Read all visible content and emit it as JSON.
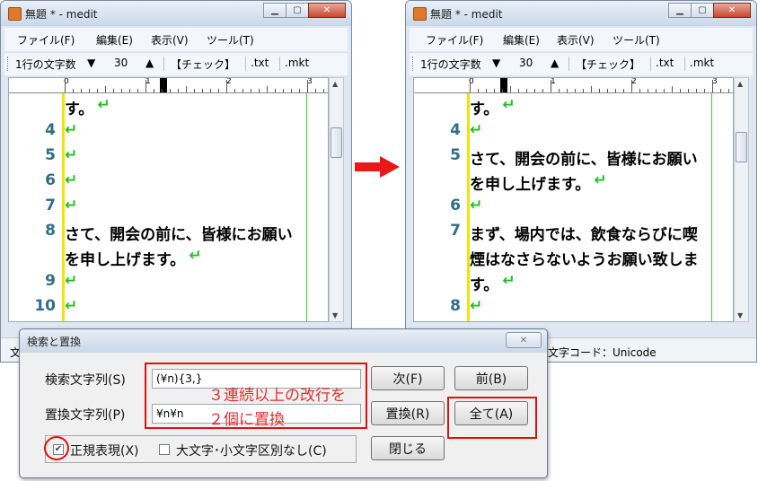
{
  "left_window": {
    "title": "無題 * - medit",
    "menu": [
      "ファイル(F)",
      "編集(E)",
      "表示(V)",
      "ツール(T)"
    ],
    "toolbar": {
      "chars_label": "1行の文字数",
      "down": "▼",
      "value": "30",
      "up": "▲",
      "check": "【チェック】",
      "txt": ".txt",
      "mkt": ".mkt"
    },
    "ruler": [
      "0",
      "1",
      "2",
      "3"
    ],
    "lines": [
      {
        "num": "",
        "text": "す。",
        "ret": "↵"
      },
      {
        "num": "4",
        "text": "",
        "ret": "↵"
      },
      {
        "num": "5",
        "text": "",
        "ret": "↵"
      },
      {
        "num": "6",
        "text": "",
        "ret": "↵"
      },
      {
        "num": "7",
        "text": "",
        "ret": "↵"
      },
      {
        "num": "8",
        "text": "さて、開会の前に、皆様にお願い",
        "ret": ""
      },
      {
        "num": "",
        "text": "を申し上げます。",
        "ret": "↵"
      },
      {
        "num": "9",
        "text": "",
        "ret": "↵"
      },
      {
        "num": "10",
        "text": "",
        "ret": "↵"
      }
    ],
    "status": "文"
  },
  "right_window": {
    "title": "無題 * - medit",
    "menu": [
      "ファイル(F)",
      "編集(E)",
      "表示(V)",
      "ツール(T)"
    ],
    "toolbar": {
      "chars_label": "1行の文字数",
      "down": "▼",
      "value": "30",
      "up": "▲",
      "check": "【チェック】",
      "txt": ".txt",
      "mkt": ".mkt"
    },
    "ruler": [
      "0",
      "1",
      "2",
      "3"
    ],
    "lines": [
      {
        "num": "",
        "text": "す。",
        "ret": "↵"
      },
      {
        "num": "4",
        "text": "",
        "ret": "↵"
      },
      {
        "num": "5",
        "text": "さて、開会の前に、皆様にお願い",
        "ret": ""
      },
      {
        "num": "",
        "text": "を申し上げます。",
        "ret": "↵"
      },
      {
        "num": "6",
        "text": "",
        "ret": "↵"
      },
      {
        "num": "7",
        "text": "まず、場内では、飲食ならびに喫",
        "ret": ""
      },
      {
        "num": "",
        "text": "煙はなさらないようお願い致しま",
        "ret": ""
      },
      {
        "num": "",
        "text": "す。",
        "ret": "↵"
      },
      {
        "num": "8",
        "text": "",
        "ret": "↵"
      }
    ],
    "status": "文字コード：Unicode"
  },
  "dialog": {
    "title": "検索と置換",
    "search_label": "検索文字列(S)",
    "search_value": "(¥n){3,}",
    "replace_label": "置換文字列(P)",
    "replace_value": "¥n¥n",
    "regex_label": "正規表現(X)",
    "case_label": "大文字･小文字区別なし(C)",
    "next_btn": "次(F)",
    "prev_btn": "前(B)",
    "replace_btn": "置換(R)",
    "replace_all_btn": "全て(A)",
    "close_btn": "閉じる",
    "annotation_line1": "３連続以上の改行を",
    "annotation_line2": "２個に置換"
  },
  "colors": {
    "line_number": "#2e6e86",
    "return_mark": "#22c022",
    "annotation": "#e01010"
  }
}
